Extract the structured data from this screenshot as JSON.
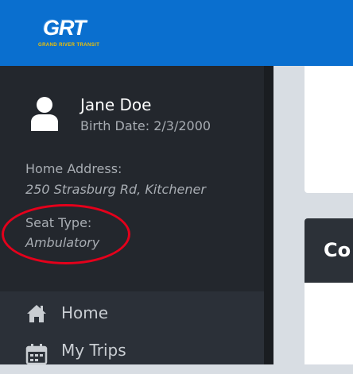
{
  "header": {
    "logo_text": "GRT",
    "logo_subtitle": "GRAND RIVER TRANSIT",
    "background_color": "#0a6fcf"
  },
  "profile": {
    "avatar_icon": "user-icon",
    "name": "Jane Doe",
    "birth_date": "Birth Date: 2/3/2000",
    "home_address_label": "Home Address:",
    "home_address_value": "250 Strasburg Rd, Kitchener",
    "seat_type_label": "Seat Type:",
    "seat_type_value": "Ambulatory",
    "highlight_color": "#e4001b"
  },
  "nav": {
    "items": [
      {
        "label": "Home",
        "icon": "home-icon"
      },
      {
        "label": "My Trips",
        "icon": "calendar-icon"
      }
    ]
  },
  "main": {
    "card_title": "Co"
  }
}
